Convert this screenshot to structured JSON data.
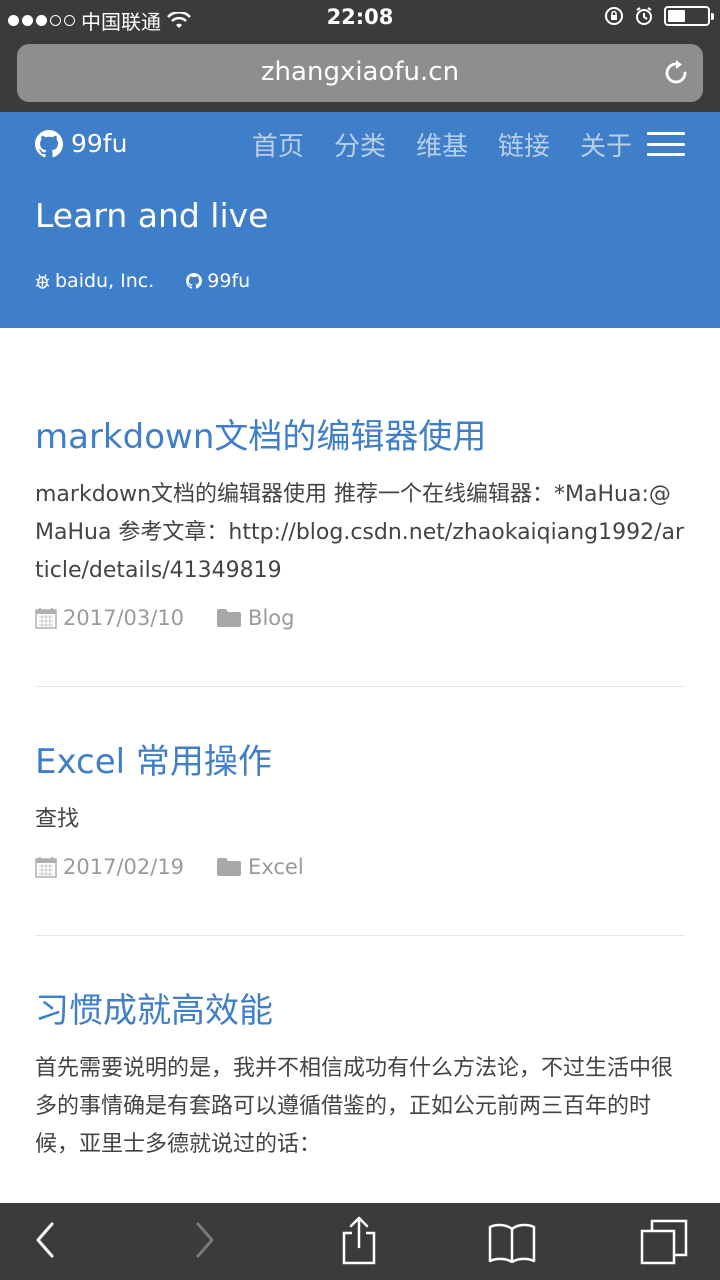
{
  "status": {
    "carrier": "中国联通",
    "time": "22:08",
    "signal_bars_filled": 3,
    "signal_bars_total": 5,
    "battery_level": 0.45
  },
  "browser": {
    "url": "zhangxiaofu.cn"
  },
  "header": {
    "brand": "99fu",
    "nav": [
      "首页",
      "分类",
      "维基",
      "链接",
      "关于"
    ],
    "tagline": "Learn and live",
    "company": "baidu, Inc.",
    "github": "99fu",
    "color": "#3f7ec8"
  },
  "posts": [
    {
      "title": "markdown文档的编辑器使用",
      "body": "markdown文档的编辑器使用 推荐一个在线编辑器：*MaHua:@MaHua 参考文章：http://blog.csdn.net/zhaokaiqiang1992/article/details/41349819",
      "date": "2017/03/10",
      "category": "Blog"
    },
    {
      "title": "Excel 常用操作",
      "body": "查找",
      "date": "2017/02/19",
      "category": "Excel"
    },
    {
      "title": "习惯成就高效能",
      "body": "首先需要说明的是，我并不相信成功有什么方法论，不过生活中很多的事情确是有套路可以遵循借鉴的，正如公元前两三百年的时候，亚里士多德就说过的话："
    }
  ],
  "icons": {
    "brand": "github-icon",
    "company": "bug-icon",
    "date": "calendar-icon",
    "category": "folder-icon",
    "reload": "reload-icon",
    "back": "back-icon",
    "forward": "forward-icon",
    "share": "share-icon",
    "bookmarks": "bookmarks-icon",
    "tabs": "tabs-icon"
  }
}
